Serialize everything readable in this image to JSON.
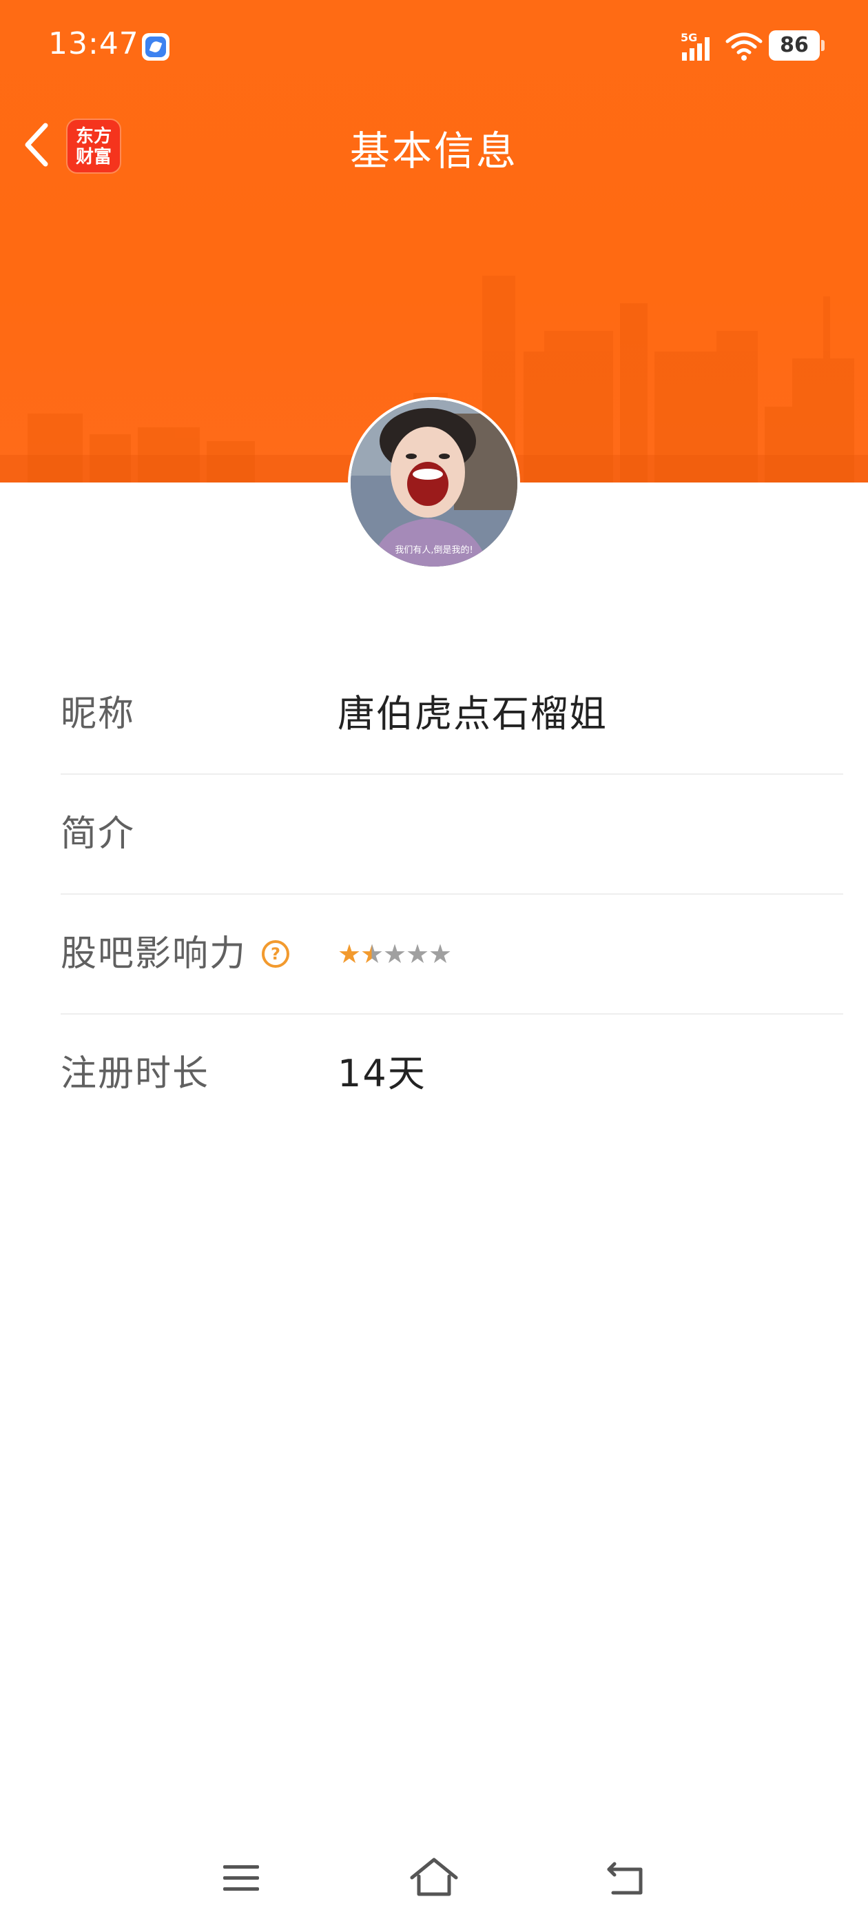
{
  "status_bar": {
    "time": "13:47",
    "network": "5G",
    "battery": "86"
  },
  "nav": {
    "title": "基本信息",
    "brand_line1": "东方",
    "brand_line2": "财富"
  },
  "avatar": {
    "caption": "我们有人,倒是我的!"
  },
  "profile": {
    "nickname_label": "昵称",
    "nickname_value": "唐伯虎点石榴姐",
    "intro_label": "简介",
    "intro_value": "",
    "influence_label": "股吧影响力",
    "influence_rating": 1.5,
    "influence_max": 5,
    "registration_label": "注册时长",
    "registration_value": "14天"
  },
  "colors": {
    "brand_orange": "#ff6b14",
    "star_active": "#f29a2e",
    "star_inactive": "#a0a0a0"
  }
}
